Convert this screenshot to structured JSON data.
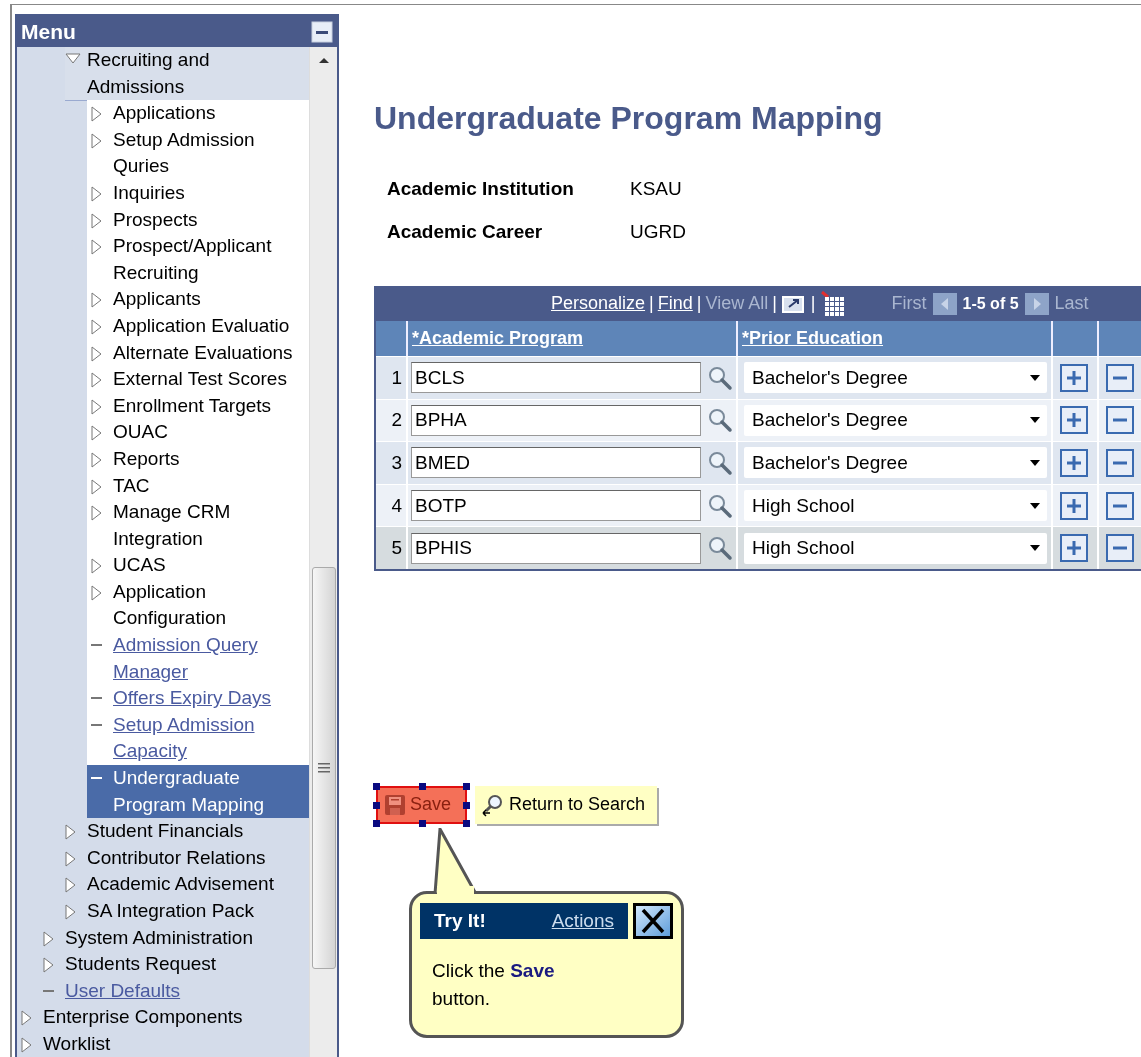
{
  "menu": {
    "title": "Menu",
    "items": [
      {
        "children": [
          {
            "children": [
              {
                "label": "Recruiting and Admissions",
                "kind": "folder",
                "expanded": true,
                "selected": false,
                "children": [
                  {
                    "label": "Applications",
                    "kind": "folder",
                    "expanded": false,
                    "selected": false
                  },
                  {
                    "label": "Setup Admission Quries",
                    "kind": "folder",
                    "expanded": false,
                    "selected": false
                  },
                  {
                    "label": "Inquiries",
                    "kind": "folder",
                    "expanded": false,
                    "selected": false
                  },
                  {
                    "label": "Prospects",
                    "kind": "folder",
                    "expanded": false,
                    "selected": false
                  },
                  {
                    "label": "Prospect/Applicant Recruiting",
                    "kind": "folder",
                    "expanded": false,
                    "selected": false
                  },
                  {
                    "label": "Applicants",
                    "kind": "folder",
                    "expanded": false,
                    "selected": false
                  },
                  {
                    "label": "Application Evaluatio",
                    "kind": "folder",
                    "expanded": false,
                    "selected": false
                  },
                  {
                    "label": "Alternate Evaluations",
                    "kind": "folder",
                    "expanded": false,
                    "selected": false
                  },
                  {
                    "label": "External Test Scores",
                    "kind": "folder",
                    "expanded": false,
                    "selected": false
                  },
                  {
                    "label": "Enrollment Targets",
                    "kind": "folder",
                    "expanded": false,
                    "selected": false
                  },
                  {
                    "label": "OUAC",
                    "kind": "folder",
                    "expanded": false,
                    "selected": false
                  },
                  {
                    "label": "Reports",
                    "kind": "folder",
                    "expanded": false,
                    "selected": false
                  },
                  {
                    "label": "TAC",
                    "kind": "folder",
                    "expanded": false,
                    "selected": false
                  },
                  {
                    "label": "Manage CRM Integration",
                    "kind": "folder",
                    "expanded": false,
                    "selected": false
                  },
                  {
                    "label": "UCAS",
                    "kind": "folder",
                    "expanded": false,
                    "selected": false
                  },
                  {
                    "label": "Application Configuration",
                    "kind": "folder",
                    "expanded": false,
                    "selected": false
                  },
                  {
                    "label": "Admission Query Manager",
                    "kind": "link",
                    "selected": false
                  },
                  {
                    "label": "Offers Expiry Days",
                    "kind": "link",
                    "selected": false
                  },
                  {
                    "label": "Setup Admission Capacity",
                    "kind": "link",
                    "selected": false
                  },
                  {
                    "label": "Undergraduate Program Mapping",
                    "kind": "link",
                    "selected": true
                  }
                ]
              },
              {
                "label": "Student Financials",
                "kind": "folder",
                "expanded": false,
                "selected": false
              },
              {
                "label": "Contributor Relations",
                "kind": "folder",
                "expanded": false,
                "selected": false
              },
              {
                "label": "Academic Advisement",
                "kind": "folder",
                "expanded": false,
                "selected": false
              },
              {
                "label": "SA Integration Pack",
                "kind": "folder",
                "expanded": false,
                "selected": false
              }
            ]
          },
          {
            "label": "System Administration",
            "kind": "folder",
            "expanded": false,
            "selected": false
          },
          {
            "label": "Students Request",
            "kind": "folder",
            "expanded": false,
            "selected": false
          },
          {
            "label": "User Defaults",
            "kind": "link",
            "selected": false
          }
        ]
      },
      {
        "label": "Enterprise Components",
        "kind": "folder",
        "expanded": false,
        "selected": false
      },
      {
        "label": "Worklist",
        "kind": "folder",
        "expanded": false,
        "selected": false
      }
    ]
  },
  "page": {
    "title": "Undergraduate Program Mapping",
    "fields": [
      {
        "label": "Academic Institution",
        "value": "KSAU"
      },
      {
        "label": "Academic Career",
        "value": "UGRD"
      }
    ],
    "grid": {
      "toolbar": [
        {
          "label": "Personalize",
          "kind": "link",
          "disabled": false
        },
        {
          "label": "Find",
          "kind": "link",
          "disabled": false
        },
        {
          "label": "View All",
          "kind": "link",
          "disabled": true
        },
        {
          "kind": "popout"
        },
        {
          "kind": "download"
        }
      ],
      "separator": "|",
      "pager": {
        "first": "First",
        "range": "1-5 of 5",
        "last": "Last"
      },
      "columns": [
        "*Academic Program",
        "*Prior Education"
      ],
      "rows": [
        {
          "number": "1",
          "program": "BCLS",
          "prior_education": "Bachelor's Degree"
        },
        {
          "number": "2",
          "program": "BPHA",
          "prior_education": "Bachelor's Degree"
        },
        {
          "number": "3",
          "program": "BMED",
          "prior_education": "Bachelor's Degree"
        },
        {
          "number": "4",
          "program": "BOTP",
          "prior_education": "High School"
        },
        {
          "number": "5",
          "program": "BPHIS",
          "prior_education": "High School"
        }
      ]
    }
  },
  "buttons": [
    {
      "label": "Save",
      "kind": "save",
      "highlighted": true
    },
    {
      "label": "Return to Search",
      "kind": "return",
      "highlighted": false
    }
  ],
  "callout": {
    "title": "Try It!",
    "link": "Actions",
    "text": "Click the **Save** button."
  }
}
